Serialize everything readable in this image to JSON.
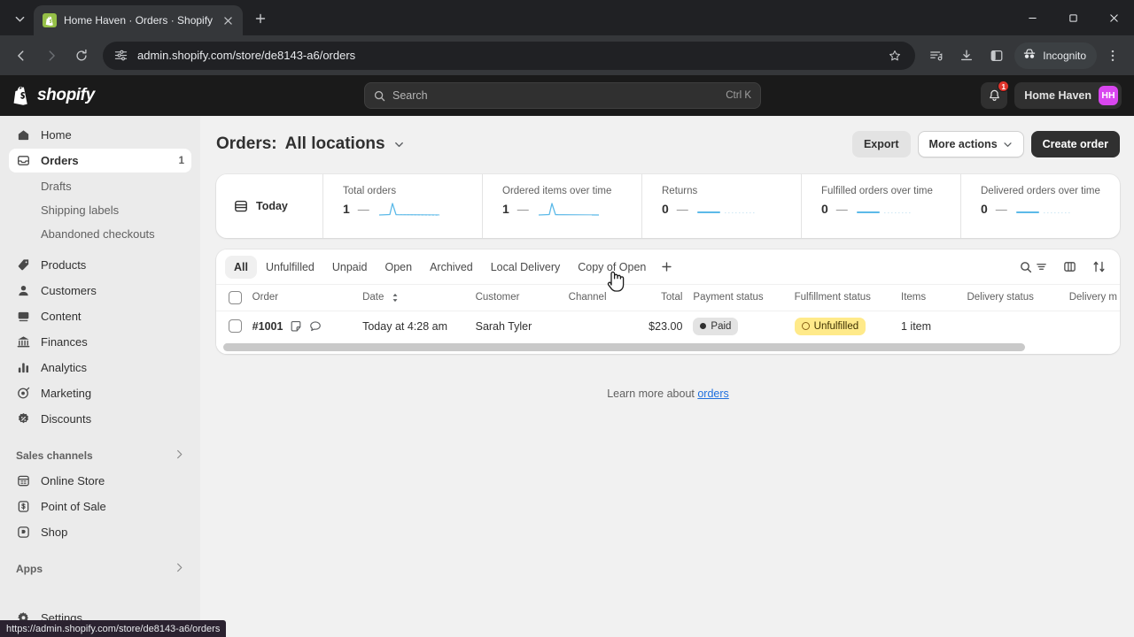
{
  "browser": {
    "tab": {
      "title": "Home Haven · Orders · Shopify",
      "favicon": "shopify-bag-icon"
    },
    "new_tab_label": "+",
    "url": "admin.shopify.com/store/de8143-a6/orders",
    "status_url": "https://admin.shopify.com/store/de8143-a6/orders",
    "incognito_label": "Incognito",
    "icons": {
      "tab_list": "chevron-down-icon",
      "back": "back-arrow-icon",
      "forward": "forward-arrow-icon",
      "reload": "reload-icon",
      "site_info": "page-settings-icon",
      "bookmark": "star-icon",
      "reading_list": "reading-list-icon",
      "downloads": "download-icon",
      "side_panel": "side-panel-icon",
      "menu": "three-dot-menu-icon",
      "minimize": "minimize-icon",
      "maximize": "maximize-icon",
      "close": "close-icon"
    }
  },
  "topbar": {
    "brand": "shopify",
    "search_placeholder": "Search",
    "search_shortcut": "Ctrl K",
    "notification_count": "1",
    "store_name": "Home Haven",
    "avatar_initials": "HH"
  },
  "sidebar": {
    "items": [
      {
        "label": "Home",
        "icon": "home-icon",
        "badge": "",
        "active": false
      },
      {
        "label": "Orders",
        "icon": "orders-inbox-icon",
        "badge": "1",
        "active": true
      }
    ],
    "sub_items": [
      {
        "label": "Drafts"
      },
      {
        "label": "Shipping labels"
      },
      {
        "label": "Abandoned checkouts"
      }
    ],
    "items2": [
      {
        "label": "Products",
        "icon": "tag-icon"
      },
      {
        "label": "Customers",
        "icon": "person-icon"
      },
      {
        "label": "Content",
        "icon": "content-icon"
      },
      {
        "label": "Finances",
        "icon": "bank-icon"
      },
      {
        "label": "Analytics",
        "icon": "bar-chart-icon"
      },
      {
        "label": "Marketing",
        "icon": "megaphone-target-icon"
      },
      {
        "label": "Discounts",
        "icon": "discount-badge-icon"
      }
    ],
    "sales_channels_label": "Sales channels",
    "channels": [
      {
        "label": "Online Store",
        "icon": "storefront-icon"
      },
      {
        "label": "Point of Sale",
        "icon": "pos-icon"
      },
      {
        "label": "Shop",
        "icon": "shop-icon"
      }
    ],
    "apps_label": "Apps",
    "settings_label": "Settings"
  },
  "page": {
    "title_prefix": "Orders:",
    "title_location": "All locations",
    "export_label": "Export",
    "more_actions_label": "More actions",
    "create_order_label": "Create order"
  },
  "metrics": {
    "today_label": "Today",
    "cards": [
      {
        "label": "Total orders",
        "value": "1",
        "trend": "—",
        "spark": "spike"
      },
      {
        "label": "Ordered items over time",
        "value": "1",
        "trend": "—",
        "spark": "spike"
      },
      {
        "label": "Returns",
        "value": "0",
        "trend": "—",
        "spark": "flat"
      },
      {
        "label": "Fulfilled orders over time",
        "value": "0",
        "trend": "—",
        "spark": "flat"
      },
      {
        "label": "Delivered orders over time",
        "value": "0",
        "trend": "—",
        "spark": "flat"
      }
    ]
  },
  "filters": {
    "tabs": [
      {
        "label": "All",
        "active": true
      },
      {
        "label": "Unfulfilled",
        "active": false
      },
      {
        "label": "Unpaid",
        "active": false
      },
      {
        "label": "Open",
        "active": false
      },
      {
        "label": "Archived",
        "active": false
      },
      {
        "label": "Local Delivery",
        "active": false
      },
      {
        "label": "Copy of Open",
        "active": false
      }
    ],
    "add_view_label": "+",
    "tool_icons": [
      "search-filter-icon",
      "column-layout-icon",
      "sort-icon"
    ]
  },
  "table": {
    "columns": [
      "Order",
      "Date",
      "Customer",
      "Channel",
      "Total",
      "Payment status",
      "Fulfillment status",
      "Items",
      "Delivery status",
      "Delivery m"
    ],
    "rows": [
      {
        "order": "#1001",
        "note_icon": "note-icon",
        "comment_icon": "comment-icon",
        "date": "Today at 4:28 am",
        "customer": "Sarah Tyler",
        "channel": "",
        "total": "$23.00",
        "payment_status": "Paid",
        "fulfillment_status": "Unfulfilled",
        "items": "1 item",
        "delivery_status": "",
        "delivery_method": ""
      }
    ]
  },
  "footer": {
    "learn_prefix": "Learn more about ",
    "learn_link": "orders"
  },
  "colors": {
    "accent_dark": "#303030",
    "avatar": "#d946ef",
    "badge_warning": "#ffea8a",
    "link": "#1f6fde",
    "spark_line": "#5bb9e8",
    "notification": "#e0342c"
  }
}
